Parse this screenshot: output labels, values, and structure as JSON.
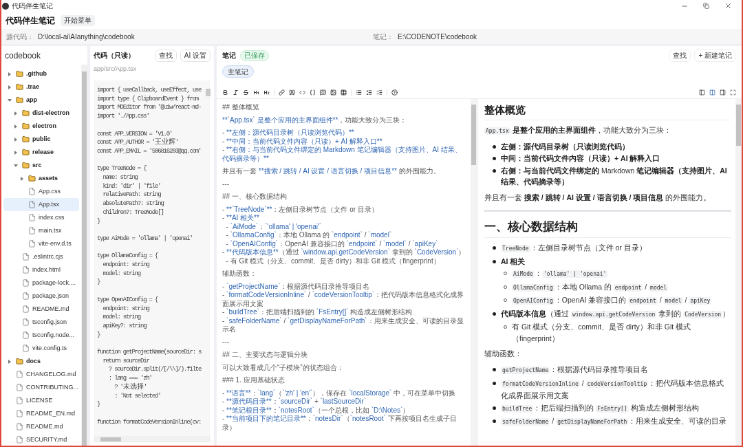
{
  "window": {
    "title": "代码伴生笔记"
  },
  "app": {
    "title": "代码伴生笔记",
    "menu_button": "开始菜单"
  },
  "paths": [
    {
      "label": "源代码：",
      "value": "D:\\local-ai\\AIanything\\codebook"
    },
    {
      "label": "笔记：",
      "value": "E:\\CODENOTE\\codebook"
    }
  ],
  "tree": {
    "title": "codebook",
    "items": [
      {
        "name": ".github",
        "kind": "folder",
        "expanded": false,
        "selected": false
      },
      {
        "name": ".trae",
        "kind": "folder",
        "expanded": false,
        "selected": false
      },
      {
        "name": "app",
        "kind": "folder",
        "expanded": true,
        "selected": false,
        "children": [
          {
            "name": "dist-electron",
            "kind": "folder",
            "expanded": false,
            "selected": false
          },
          {
            "name": "electron",
            "kind": "folder",
            "expanded": false,
            "selected": false
          },
          {
            "name": "public",
            "kind": "folder",
            "expanded": false,
            "selected": false
          },
          {
            "name": "release",
            "kind": "folder",
            "expanded": false,
            "selected": false
          },
          {
            "name": "src",
            "kind": "folder",
            "expanded": true,
            "selected": false,
            "children": [
              {
                "name": "assets",
                "kind": "folder",
                "expanded": false,
                "selected": false
              },
              {
                "name": "App.css",
                "kind": "file",
                "selected": false
              },
              {
                "name": "App.tsx",
                "kind": "file",
                "selected": true
              },
              {
                "name": "index.css",
                "kind": "file",
                "selected": false
              },
              {
                "name": "main.tsx",
                "kind": "file",
                "selected": false
              },
              {
                "name": "vite-env.d.ts",
                "kind": "file",
                "selected": false
              }
            ]
          },
          {
            "name": ".eslintrc.cjs",
            "kind": "file",
            "selected": false
          },
          {
            "name": "index.html",
            "kind": "file",
            "selected": false
          },
          {
            "name": "package-lock....",
            "kind": "file",
            "selected": false
          },
          {
            "name": "package.json",
            "kind": "file",
            "selected": false
          },
          {
            "name": "README.md",
            "kind": "file",
            "selected": false
          },
          {
            "name": "tsconfig.json",
            "kind": "file",
            "selected": false
          },
          {
            "name": "tsconfig.node...",
            "kind": "file",
            "selected": false
          },
          {
            "name": "vite.config.ts",
            "kind": "file",
            "selected": false
          }
        ]
      },
      {
        "name": "docs",
        "kind": "folder",
        "expanded": false,
        "selected": false
      },
      {
        "name": "CHANGELOG.md",
        "kind": "file",
        "selected": false
      },
      {
        "name": "CONTRIBUTING...",
        "kind": "file",
        "selected": false
      },
      {
        "name": "LICENSE",
        "kind": "file",
        "selected": false
      },
      {
        "name": "README_EN.md",
        "kind": "file",
        "selected": false
      },
      {
        "name": "README.md",
        "kind": "file",
        "selected": false
      },
      {
        "name": "SECURITY.md",
        "kind": "file",
        "selected": false
      }
    ]
  },
  "code": {
    "title": "代码（只读）",
    "buttons": [
      "查找",
      "AI 设置"
    ],
    "path": "app/src/App.tsx",
    "blocks": [
      [
        "import { useCallback, useEffect, use",
        "import type { ClipboardEvent } from",
        "import MDEditor from '@uiw/react-md-",
        "import './App.css'"
      ],
      [
        "const APP_VERSION = 'V1.0'",
        "const APP_AUTHOR = '王业辉'",
        "const APP_EMAIL = '506816203@qq.com'"
      ],
      [
        "type TreeNode = {",
        "  name: string",
        "  kind: 'dir' | 'file'",
        "  relativePath: string",
        "  absolutePath?: string",
        "  children?: TreeNode[]",
        "}"
      ],
      [
        "type AiMode = 'ollama' | 'openai'"
      ],
      [
        "type OllamaConfig = {",
        "  endpoint: string",
        "  model: string",
        "}"
      ],
      [
        "type OpenAIConfig = {",
        "  endpoint: string",
        "  model: string",
        "  apiKey?: string",
        "}"
      ],
      [
        "function getProjectName(sourceDir: s",
        "  return sourceDir",
        "    ? sourceDir.split(/[/\\\\]/).filte",
        "    : lang === 'zh'",
        "      ? '未选择'",
        "      : 'Not selected'",
        "}"
      ],
      [
        "function formatCodeVersionInline(cv:"
      ]
    ]
  },
  "notes": {
    "title": "笔记",
    "status": "已保存",
    "buttons": [
      "查找",
      "+ 新建笔记"
    ],
    "tabs": [
      {
        "label": "主笔记",
        "selected": true
      }
    ],
    "editor": {
      "blocks": [
        [
          [
            {
              "text": "## 整体概览",
              "kind": "plain"
            }
          ]
        ],
        [
          [
            {
              "text": "**`App.tsx` 是整个应用的主界面组件**",
              "kind": "mark"
            },
            {
              "text": "，功能大致分为三块：",
              "kind": "plain"
            }
          ]
        ],
        [
          [
            {
              "text": "- ",
              "kind": "plain"
            },
            {
              "text": "**左侧：源代码目录树（只读浏览代码）**",
              "kind": "mark"
            }
          ],
          [
            {
              "text": "- ",
              "kind": "plain"
            },
            {
              "text": "**中间：当前代码文件内容（只读）+ AI 解释入口**",
              "kind": "mark"
            }
          ],
          [
            {
              "text": "- ",
              "kind": "plain"
            },
            {
              "text": "**右侧：与当前代码文件绑定的 Markdown 笔记编辑器（支持图片、AI 结果、代码摘录等）**",
              "kind": "mark"
            }
          ]
        ],
        [
          [
            {
              "text": "并且有一套 ",
              "kind": "plain"
            },
            {
              "text": "**搜索 / 跳转 / AI 设置 / 语言切换 / 项目信息**",
              "kind": "mark"
            },
            {
              "text": " 的外围能力。",
              "kind": "plain"
            }
          ]
        ],
        [
          [
            {
              "text": "---",
              "kind": "plain"
            }
          ]
        ],
        [
          [
            {
              "text": "## 一、核心数据结构",
              "kind": "plain"
            }
          ]
        ],
        [
          [
            {
              "text": "- ",
              "kind": "plain"
            },
            {
              "text": "**`TreeNode`**",
              "kind": "mark"
            },
            {
              "text": "：左侧目录树节点（文件 or 目录）",
              "kind": "plain"
            }
          ],
          [
            {
              "text": "- ",
              "kind": "plain"
            },
            {
              "text": "**AI 相关**",
              "kind": "mark"
            }
          ],
          [
            {
              "text": "  - ",
              "kind": "plain"
            },
            {
              "text": "`AiMode`",
              "kind": "mark"
            },
            {
              "text": "：",
              "kind": "plain"
            },
            {
              "text": "`'ollama' | 'openai'`",
              "kind": "mark"
            }
          ],
          [
            {
              "text": "  - ",
              "kind": "plain"
            },
            {
              "text": "`OllamaConfig`",
              "kind": "mark"
            },
            {
              "text": "：本地 Ollama 的 ",
              "kind": "plain"
            },
            {
              "text": "`endpoint`",
              "kind": "mark"
            },
            {
              "text": " / ",
              "kind": "plain"
            },
            {
              "text": "`model`",
              "kind": "mark"
            }
          ],
          [
            {
              "text": "  - ",
              "kind": "plain"
            },
            {
              "text": "`OpenAIConfig`",
              "kind": "mark"
            },
            {
              "text": "：OpenAI 兼容接口的 ",
              "kind": "plain"
            },
            {
              "text": "`endpoint`",
              "kind": "mark"
            },
            {
              "text": " / ",
              "kind": "plain"
            },
            {
              "text": "`model`",
              "kind": "mark"
            },
            {
              "text": " / ",
              "kind": "plain"
            },
            {
              "text": "`apiKey`",
              "kind": "mark"
            }
          ],
          [
            {
              "text": "- ",
              "kind": "plain"
            },
            {
              "text": "**代码版本信息**",
              "kind": "mark"
            },
            {
              "text": "（通过 ",
              "kind": "plain"
            },
            {
              "text": "`window.api.getCodeVersion`",
              "kind": "mark"
            },
            {
              "text": " 拿到的 ",
              "kind": "plain"
            },
            {
              "text": "`CodeVersion`",
              "kind": "mark"
            },
            {
              "text": "）",
              "kind": "plain"
            }
          ],
          [
            {
              "text": "  - 有 Git 模式（分支、commit、是否 dirty）和非 Git 模式（fingerprint）",
              "kind": "plain"
            }
          ]
        ],
        [
          [
            {
              "text": "辅助函数：",
              "kind": "plain"
            }
          ]
        ],
        [
          [
            {
              "text": "- ",
              "kind": "plain"
            },
            {
              "text": "`getProjectName`",
              "kind": "mark"
            },
            {
              "text": "：根据源代码目录推导项目名",
              "kind": "plain"
            }
          ],
          [
            {
              "text": "- ",
              "kind": "plain"
            },
            {
              "text": "`formatCodeVersionInline`",
              "kind": "mark"
            },
            {
              "text": " / ",
              "kind": "plain"
            },
            {
              "text": "`codeVersionTooltip`",
              "kind": "mark"
            },
            {
              "text": "：把代码版本信息格式化成界面展示用文案",
              "kind": "plain"
            }
          ],
          [
            {
              "text": "- ",
              "kind": "plain"
            },
            {
              "text": "`buildTree`",
              "kind": "mark"
            },
            {
              "text": "：把后端扫描到的 ",
              "kind": "plain"
            },
            {
              "text": "`FsEntry[]`",
              "kind": "mark"
            },
            {
              "text": " 构造成左侧树形结构",
              "kind": "plain"
            }
          ],
          [
            {
              "text": "- ",
              "kind": "plain"
            },
            {
              "text": "`safeFolderName`",
              "kind": "mark"
            },
            {
              "text": " / ",
              "kind": "plain"
            },
            {
              "text": "`getDisplayNameForPath`",
              "kind": "mark"
            },
            {
              "text": "：用来生成安全、可读的目录显示名",
              "kind": "plain"
            }
          ]
        ],
        [
          [
            {
              "text": "---",
              "kind": "plain"
            }
          ]
        ],
        [
          [
            {
              "text": "## 二、主要状态与逻辑分块",
              "kind": "plain"
            }
          ]
        ],
        [
          [
            {
              "text": "可以大致看成几个“子模块”的状态组合：",
              "kind": "plain"
            }
          ]
        ],
        [
          [
            {
              "text": "### 1. 应用基础状态",
              "kind": "plain"
            }
          ]
        ],
        [
          [
            {
              "text": "- ",
              "kind": "plain"
            },
            {
              "text": "**语言**",
              "kind": "mark"
            },
            {
              "text": "：",
              "kind": "plain"
            },
            {
              "text": "`lang`",
              "kind": "mark"
            },
            {
              "text": "（",
              "kind": "plain"
            },
            {
              "text": "`'zh' | 'en'`",
              "kind": "mark"
            },
            {
              "text": "），保存在 ",
              "kind": "plain"
            },
            {
              "text": "`localStorage`",
              "kind": "mark"
            },
            {
              "text": " 中，可在菜单中切换",
              "kind": "plain"
            }
          ],
          [
            {
              "text": "- ",
              "kind": "plain"
            },
            {
              "text": "**源代码目录**",
              "kind": "mark"
            },
            {
              "text": "：",
              "kind": "plain"
            },
            {
              "text": "`sourceDir`",
              "kind": "mark"
            },
            {
              "text": " + ",
              "kind": "plain"
            },
            {
              "text": "`lastSourceDir`",
              "kind": "mark"
            }
          ],
          [
            {
              "text": "- ",
              "kind": "plain"
            },
            {
              "text": "**笔记根目录**",
              "kind": "mark"
            },
            {
              "text": "：",
              "kind": "plain"
            },
            {
              "text": "`notesRoot`",
              "kind": "mark"
            },
            {
              "text": "（一个总根，比如 ",
              "kind": "plain"
            },
            {
              "text": "`D:\\Notes`",
              "kind": "mark"
            },
            {
              "text": "）",
              "kind": "plain"
            }
          ],
          [
            {
              "text": "- ",
              "kind": "plain"
            },
            {
              "text": "**当前项目下的笔记目录**",
              "kind": "mark"
            },
            {
              "text": "：",
              "kind": "plain"
            },
            {
              "text": "`notesDir`",
              "kind": "mark"
            },
            {
              "text": "（",
              "kind": "plain"
            },
            {
              "text": "`notesRoot`",
              "kind": "mark"
            },
            {
              "text": " 下再按项目名生成子目录）",
              "kind": "plain"
            }
          ]
        ]
      ]
    },
    "preview": {
      "blocks": [
        {
          "kind": "h1",
          "text": "整体概览"
        },
        {
          "kind": "p",
          "segments": [
            {
              "text": "App.tsx",
              "kind": "code"
            },
            {
              "text": " 是整个应用的主界面组件",
              "kind": "bold"
            },
            {
              "text": "，功能大致分为三块：",
              "kind": "plain"
            }
          ]
        },
        {
          "kind": "ul",
          "items": [
            {
              "segments": [
                {
                  "text": "左侧：源代码目录树（只读浏览代码）",
                  "kind": "bold"
                }
              ]
            },
            {
              "segments": [
                {
                  "text": "中间：当前代码文件内容（只读）+ AI 解释入口",
                  "kind": "bold"
                }
              ]
            },
            {
              "segments": [
                {
                  "text": "右侧：与当前代码文件绑定的 ",
                  "kind": "bold"
                },
                {
                  "text": "Markdown",
                  "kind": "plain"
                },
                {
                  "text": " 笔记编辑器（支持图片、AI 结果、代码摘录等）",
                  "kind": "bold"
                }
              ]
            }
          ]
        },
        {
          "kind": "p",
          "segments": [
            {
              "text": "并且有一套 ",
              "kind": "plain"
            },
            {
              "text": "搜索 / 跳转 / AI 设置 / 语言切换 / 项目信息",
              "kind": "bold"
            },
            {
              "text": " 的外围能力。",
              "kind": "plain"
            }
          ]
        },
        {
          "kind": "hr"
        },
        {
          "kind": "h1",
          "text": "一、核心数据结构"
        },
        {
          "kind": "ul",
          "items": [
            {
              "segments": [
                {
                  "text": "TreeNode",
                  "kind": "code"
                },
                {
                  "text": "：左侧目录树节点（文件 or 目录）",
                  "kind": "plain"
                }
              ]
            },
            {
              "segments": [
                {
                  "text": "AI 相关",
                  "kind": "bold"
                }
              ],
              "children": [
                {
                  "segments": [
                    {
                      "text": "AiMode",
                      "kind": "code"
                    },
                    {
                      "text": "：",
                      "kind": "plain"
                    },
                    {
                      "text": "'ollama' | 'openai'",
                      "kind": "code"
                    }
                  ]
                },
                {
                  "segments": [
                    {
                      "text": "OllamaConfig",
                      "kind": "code"
                    },
                    {
                      "text": "：本地 Ollama 的 ",
                      "kind": "plain"
                    },
                    {
                      "text": "endpoint",
                      "kind": "code"
                    },
                    {
                      "text": " / ",
                      "kind": "plain"
                    },
                    {
                      "text": "model",
                      "kind": "code"
                    }
                  ]
                },
                {
                  "segments": [
                    {
                      "text": "OpenAIConfig",
                      "kind": "code"
                    },
                    {
                      "text": "：OpenAI 兼容接口的 ",
                      "kind": "plain"
                    },
                    {
                      "text": "endpoint",
                      "kind": "code"
                    },
                    {
                      "text": " / ",
                      "kind": "plain"
                    },
                    {
                      "text": "model",
                      "kind": "code"
                    },
                    {
                      "text": " / ",
                      "kind": "plain"
                    },
                    {
                      "text": "apiKey",
                      "kind": "code"
                    }
                  ]
                }
              ]
            },
            {
              "segments": [
                {
                  "text": "代码版本信息",
                  "kind": "bold"
                },
                {
                  "text": "（通过 ",
                  "kind": "plain"
                },
                {
                  "text": "window.api.getCodeVersion",
                  "kind": "code"
                },
                {
                  "text": " 拿到的 ",
                  "kind": "plain"
                },
                {
                  "text": "CodeVersion",
                  "kind": "code"
                },
                {
                  "text": "）",
                  "kind": "plain"
                }
              ],
              "children": [
                {
                  "segments": [
                    {
                      "text": "有 Git 模式（分支、commit、是否 dirty）和非 Git 模式（fingerprint）",
                      "kind": "plain"
                    }
                  ]
                }
              ]
            }
          ]
        },
        {
          "kind": "p",
          "segments": [
            {
              "text": "辅助函数：",
              "kind": "plain"
            }
          ]
        },
        {
          "kind": "ul",
          "items": [
            {
              "segments": [
                {
                  "text": "getProjectName",
                  "kind": "code"
                },
                {
                  "text": "：根据源代码目录推导项目名",
                  "kind": "plain"
                }
              ]
            },
            {
              "segments": [
                {
                  "text": "formatCodeVersionInline",
                  "kind": "code"
                },
                {
                  "text": " / ",
                  "kind": "plain"
                },
                {
                  "text": "codeVersionTooltip",
                  "kind": "code"
                },
                {
                  "text": "：把代码版本信息格式化成界面展示用文案",
                  "kind": "plain"
                }
              ]
            },
            {
              "segments": [
                {
                  "text": "buildTree",
                  "kind": "code"
                },
                {
                  "text": "：把后端扫描到的 ",
                  "kind": "plain"
                },
                {
                  "text": "FsEntry[]",
                  "kind": "code"
                },
                {
                  "text": " 构造成左侧树形结构",
                  "kind": "plain"
                }
              ]
            },
            {
              "segments": [
                {
                  "text": "safeFolderName",
                  "kind": "code"
                },
                {
                  "text": " / ",
                  "kind": "plain"
                },
                {
                  "text": "getDisplayNameForPath",
                  "kind": "code"
                },
                {
                  "text": "：用来生成安全、可读的目录",
                  "kind": "plain"
                }
              ]
            }
          ]
        }
      ]
    }
  }
}
